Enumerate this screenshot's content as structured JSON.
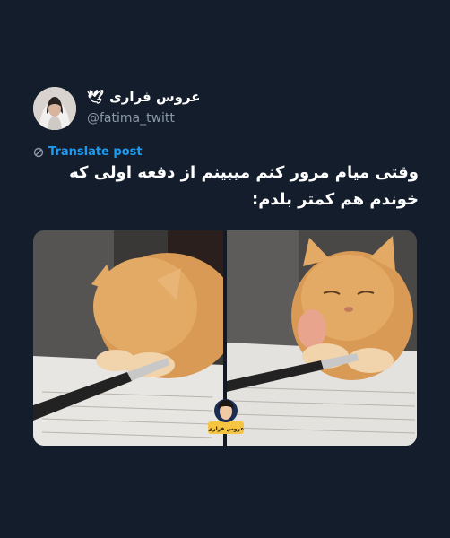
{
  "tweet": {
    "display_name": "عروس فراری",
    "handle": "@fatima_twitt",
    "translate_label": "Translate post",
    "text": "وقتی میام مرور کنم میبینم از دفعه اولی که خوندم هم کمتر بلدم:",
    "name_emoji": "🕊"
  },
  "media": {
    "watermark_label": "عروس فراری"
  },
  "colors": {
    "background": "#131d2b",
    "link": "#1d9bf0",
    "secondary_text": "#8b98a5"
  }
}
